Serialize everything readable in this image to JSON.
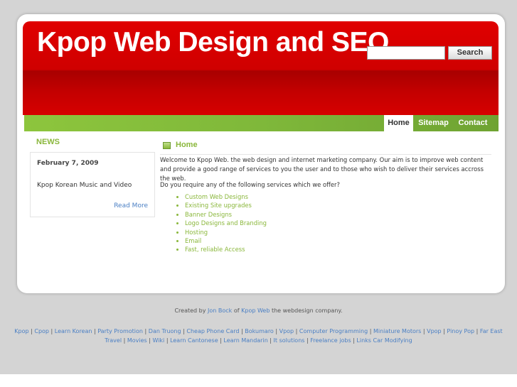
{
  "header": {
    "title": "Kpop Web Design and SEO",
    "search_placeholder": "",
    "search_button": "Search"
  },
  "nav": [
    {
      "label": "Home"
    },
    {
      "label": "Sitemap"
    },
    {
      "label": "Contact"
    }
  ],
  "news": {
    "heading": "NEWS",
    "date": "February 7, 2009",
    "text": "Kpop Korean Music and Video",
    "read_more": "Read More"
  },
  "content": {
    "heading": "Home",
    "intro": "Welcome to Kpop Web. the web design and internet marketing company. Our aim is to improve web content and provide a good range of services to you the user and to those who wish to deliver their services accross the web.",
    "question": "Do you require any of the following services which we offer?",
    "services": [
      "Custom Web Designs",
      "Existing Site upgrades",
      "Banner Designs",
      "Logo Designs and Branding",
      "Hosting",
      "Email",
      "Fast, reliable Access"
    ]
  },
  "footer": {
    "credit_prefix": "Created by",
    "credit_author": "Jon Bock",
    "credit_of": "of",
    "credit_company": "Kpop Web",
    "credit_suffix": "the webdesign company.",
    "links": [
      "Kpop",
      "Cpop",
      "Learn Korean",
      "Party Promotion",
      "Dan Truong",
      "Cheap Phone Card",
      "Bokumaro",
      "Vpop",
      "Computer Programming",
      "Miniature Motors",
      "Vpop",
      "Pinoy Pop",
      "Far East Travel",
      "Movies",
      "Wiki",
      "Learn Cantonese",
      "Learn Mandarin",
      "It solutions",
      "Freelance jobs",
      "Links Car Modifying"
    ]
  },
  "colors": {
    "header_red": "#d40000",
    "nav_green": "#7fb83a",
    "accent_green": "#8ab73b",
    "link_blue": "#4a7fc4"
  }
}
